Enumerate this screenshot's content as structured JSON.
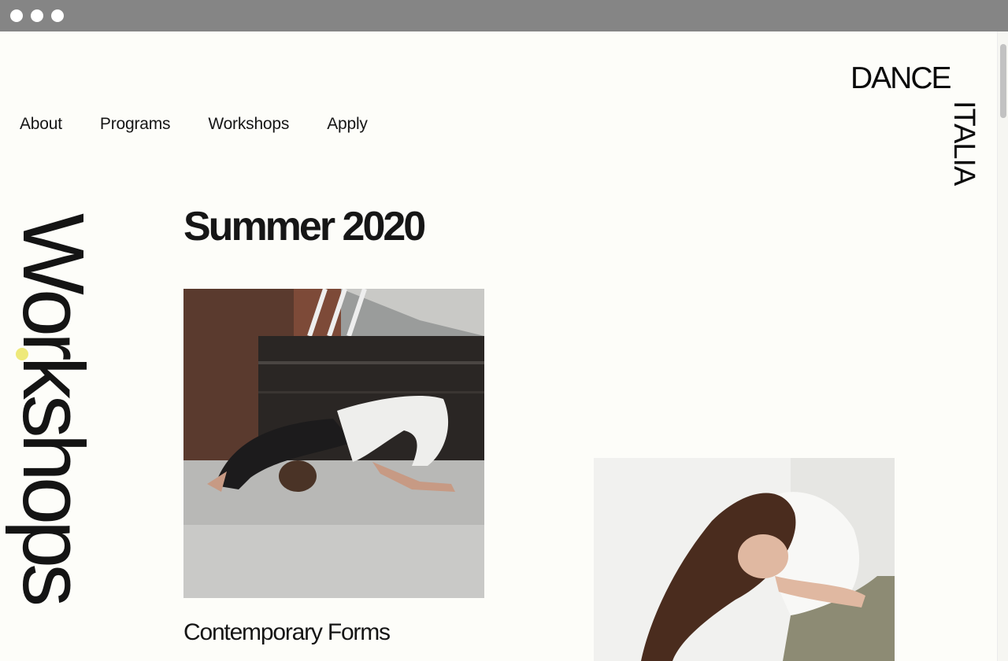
{
  "window": {
    "controls": [
      "close",
      "minimize",
      "zoom"
    ]
  },
  "nav": {
    "items": [
      "About",
      "Programs",
      "Workshops",
      "Apply"
    ]
  },
  "logo": {
    "line1": "DANCE",
    "line2": "ITALIA"
  },
  "page": {
    "vertical_title": "Workshops",
    "section_title": "Summer 2020"
  },
  "cards": [
    {
      "title": "Contemporary Forms",
      "image": "dancer-floor-photo"
    },
    {
      "title": "",
      "image": "dancer-arching-photo"
    }
  ],
  "colors": {
    "background": "#fdfdf9",
    "text": "#111111",
    "accent": "#eee97a",
    "titlebar": "#858585"
  }
}
